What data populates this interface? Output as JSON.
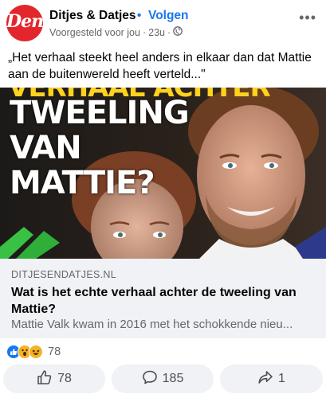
{
  "post": {
    "page_name": "Ditjes & Datjes",
    "separator": "•",
    "follow_label": "Volgen",
    "suggested_label": "Voorgesteld voor jou",
    "time": "23u",
    "dot": "·",
    "privacy_icon": "globe-icon",
    "more_label": "•••",
    "avatar_text": "DenD",
    "avatar_color": "#e3262b",
    "caption": "„Het verhaal steekt heel anders in elkaar dan dat Mattie aan de buitenwereld heeft verteld...\""
  },
  "hero": {
    "headline_top": "VERHAAL ACHTER",
    "headline_line1": "TWEELING",
    "headline_line2": "VAN MATTIE?"
  },
  "link": {
    "domain": "DITJESENDATJES.NL",
    "title": "Wat is het echte verhaal achter de tweeling van Mattie?",
    "description": "Mattie Valk kwam in 2016 met het schokkende nieu..."
  },
  "reactions": {
    "icons": [
      "like-icon",
      "wow-icon",
      "haha-icon"
    ],
    "count": "78"
  },
  "actions": {
    "like_count": "78",
    "comment_count": "185",
    "share_count": "1"
  },
  "colors": {
    "accent": "#1877f2",
    "muted": "#65676b",
    "link_bg": "#f0f2f5"
  }
}
